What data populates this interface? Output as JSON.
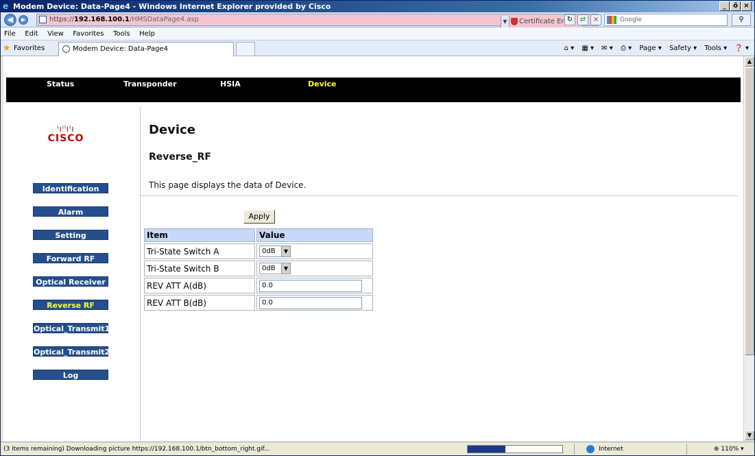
{
  "window": {
    "title": "Modem Device: Data-Page4 - Windows Internet Explorer provided by Cisco",
    "controls": [
      "_",
      "ő",
      "×"
    ]
  },
  "address": {
    "scheme": "https://",
    "host": "192.168.100.1",
    "path": "/HMSDataPage4.asp",
    "cert_error": "Certificate Error",
    "search_placeholder": "Google"
  },
  "menu": [
    "File",
    "Edit",
    "View",
    "Favorites",
    "Tools",
    "Help"
  ],
  "favorites": {
    "label": "Favorites",
    "tab_title": "Modem Device: Data-Page4",
    "commands": [
      "Page ▾",
      "Safety ▾",
      "Tools ▾"
    ]
  },
  "topnav": {
    "items": [
      {
        "label": "Status"
      },
      {
        "label": "Transponder"
      },
      {
        "label": "HSIA"
      },
      {
        "label": "Device",
        "active": true
      }
    ]
  },
  "logo": {
    "bars": "ˡıˡˡıˡı",
    "word": "CISCO"
  },
  "sidebar": {
    "items": [
      {
        "label": "Identification"
      },
      {
        "label": "Alarm"
      },
      {
        "label": "Setting"
      },
      {
        "label": "Forward RF"
      },
      {
        "label": "Optical Receiver"
      },
      {
        "label": "Reverse RF",
        "active": true
      },
      {
        "label": "Optical_Transmit1"
      },
      {
        "label": "Optical_Transmit2"
      },
      {
        "label": "Log"
      }
    ]
  },
  "main": {
    "heading": "Device",
    "subheading": "Reverse_RF",
    "description": "This page displays the data of Device.",
    "apply_label": "Apply",
    "table": {
      "headers": [
        "Item",
        "Value"
      ],
      "rows": [
        {
          "item": "Tri-State Switch A",
          "type": "select",
          "value": "0dB"
        },
        {
          "item": "Tri-State Switch B",
          "type": "select",
          "value": "0dB"
        },
        {
          "item": "REV ATT A(dB)",
          "type": "text",
          "value": "0.0"
        },
        {
          "item": "REV ATT B(dB)",
          "type": "text",
          "value": "0.0"
        }
      ]
    }
  },
  "status": {
    "message": "(3 items remaining) Downloading picture https://192.168.100.1/btn_bottom_right.gif...",
    "zone": "Internet",
    "zoom": "110%",
    "progress": 0.4
  },
  "colors": {
    "nav_active": "#ffff33",
    "sidebar_button": "#254f8c",
    "table_header": "#c8d8f8",
    "addr_error": "#f2c6d0"
  }
}
